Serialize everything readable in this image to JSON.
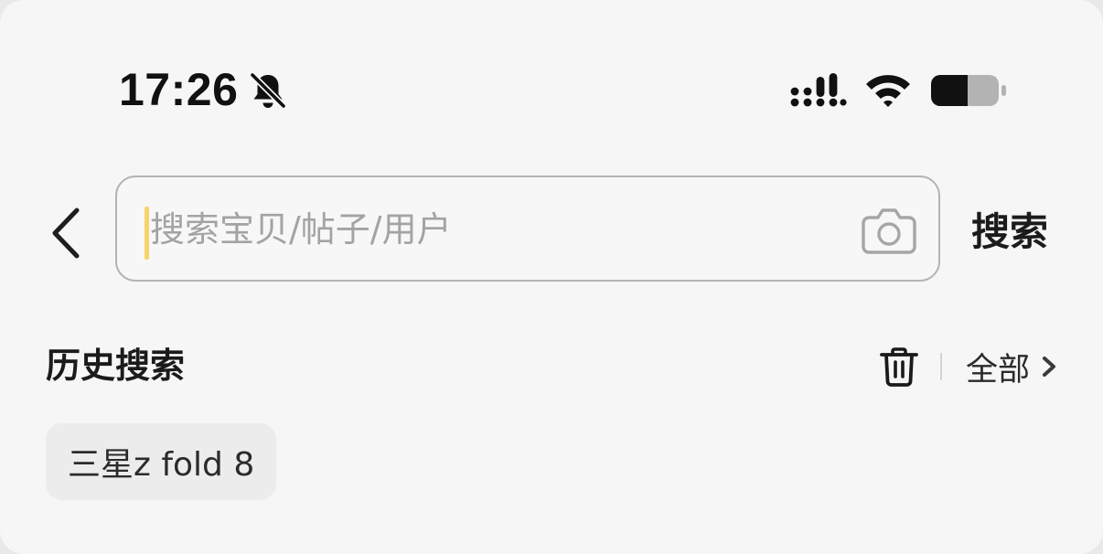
{
  "status_bar": {
    "time": "17:26",
    "icons": [
      "bell-slash-icon",
      "cellular-signal-icon",
      "wifi-icon",
      "battery-icon"
    ]
  },
  "search": {
    "placeholder": "搜索宝贝/帖子/用户",
    "value": "",
    "button_label": "搜索",
    "back_icon": "chevron-left-icon",
    "camera_icon": "camera-icon"
  },
  "history": {
    "title": "历史搜索",
    "clear_icon": "trash-icon",
    "all_label": "全部",
    "items": [
      {
        "label": "三星z fold 8"
      }
    ]
  },
  "colors": {
    "background": "#f6f6f6",
    "caret": "#f5d46a",
    "placeholder": "#a3a3a3",
    "text": "#1b1b1b",
    "chip_background": "#ececec"
  }
}
